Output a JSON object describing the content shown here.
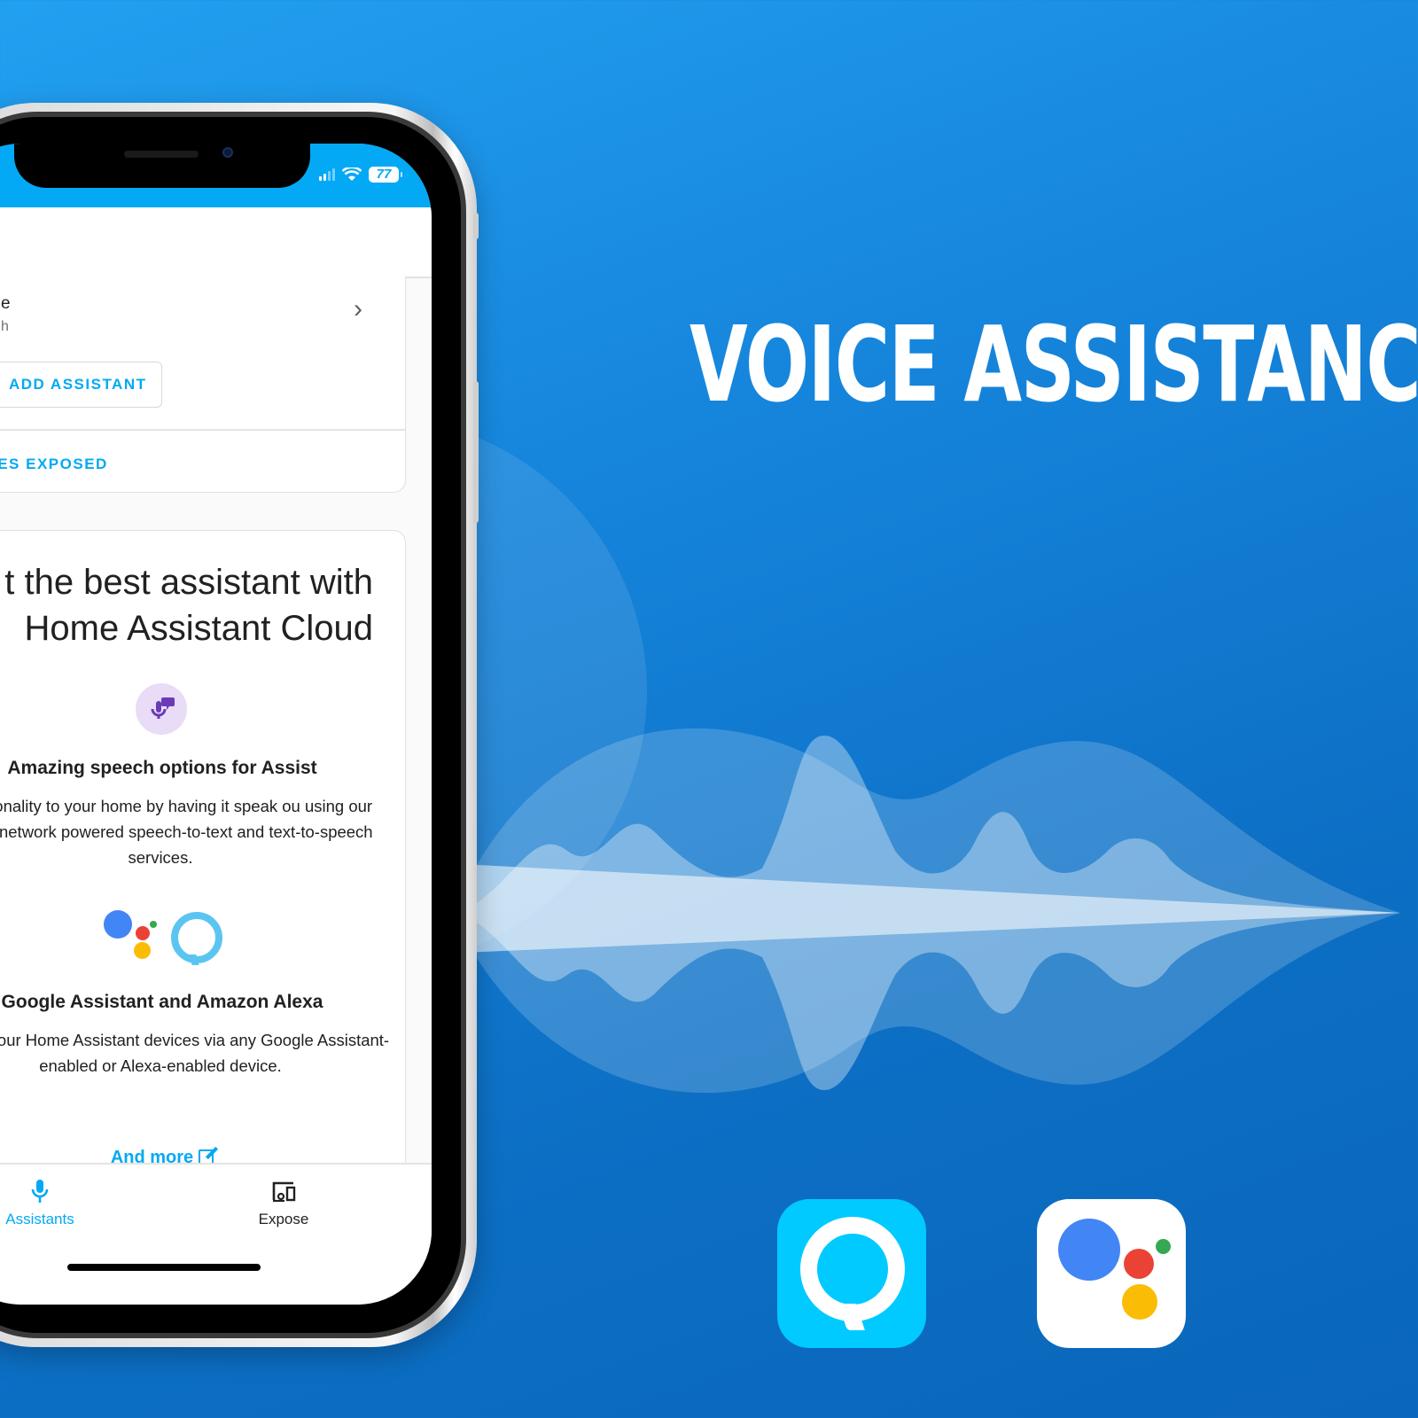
{
  "headline": "VOICE ASSISTANCE",
  "colors": {
    "background_top": "#22a0f0",
    "background_bottom": "#0a66ba",
    "ha_primary": "#03a9f4",
    "alexa_cyan": "#00caff",
    "google_blue": "#4285f4",
    "google_red": "#ea4335",
    "google_yellow": "#fbbc05",
    "google_green": "#34a853",
    "speech_icon_purple": "#6a3bb5"
  },
  "phone": {
    "status_bar": {
      "signal_icon": "cellular-signal-icon",
      "wifi_icon": "wifi-icon",
      "battery_level": "77"
    },
    "assistant_row": {
      "title_fragment": "e",
      "subtitle_fragment": "h",
      "chevron_icon": "chevron-right-icon"
    },
    "add_assistant_button": "ADD ASSISTANT",
    "entities_exposed_link": "TITIES EXPOSED",
    "promo": {
      "title": "t the best assistant with Home Assistant Cloud",
      "features": [
        {
          "icon": "microphone-message-icon",
          "heading": "Amazing speech options for Assist",
          "text": "g personality to your home by having it speak ou using our neural-network powered speech-to-text and text-to-speech services."
        },
        {
          "icon": "google-assistant-alexa-logos",
          "heading": "Google Assistant and Amazon Alexa",
          "text": "ntrol all your Home Assistant devices via any Google Assistant-enabled or Alexa-enabled device."
        }
      ],
      "more_link": "And more"
    },
    "bottom_nav": [
      {
        "label": "Assistants",
        "icon": "microphone-icon",
        "active": true
      },
      {
        "label": "Expose",
        "icon": "devices-icon",
        "active": false
      }
    ]
  },
  "app_icons": [
    {
      "name": "Amazon Alexa",
      "icon": "alexa-icon"
    },
    {
      "name": "Google Assistant",
      "icon": "google-assistant-icon"
    }
  ]
}
